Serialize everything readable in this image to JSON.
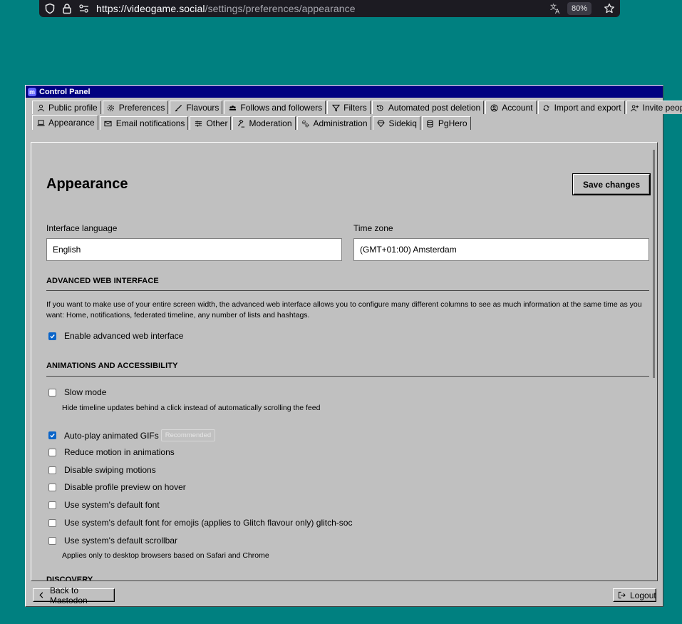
{
  "browser": {
    "url_host": "https://videogame.social",
    "url_path": "/settings/preferences/appearance",
    "zoom": "80%",
    "icons": [
      "shield-icon",
      "lock-icon",
      "site-settings-icon",
      "translate-icon",
      "star-icon"
    ]
  },
  "window": {
    "title": "Control Panel",
    "logo_letter": "m"
  },
  "tabs_row1": [
    {
      "label": "Public profile",
      "icon": "user-icon"
    },
    {
      "label": "Preferences",
      "icon": "gear-icon"
    },
    {
      "label": "Flavours",
      "icon": "paintbrush-icon"
    },
    {
      "label": "Follows and followers",
      "icon": "users-icon"
    },
    {
      "label": "Filters",
      "icon": "filter-icon"
    },
    {
      "label": "Automated post deletion",
      "icon": "history-icon"
    },
    {
      "label": "Account",
      "icon": "account-circle-icon"
    },
    {
      "label": "Import and export",
      "icon": "cloud-sync-icon"
    },
    {
      "label": "Invite people",
      "icon": "user-plus-icon"
    }
  ],
  "tabs_row2": [
    {
      "label": "Appearance",
      "icon": "laptop-icon",
      "active": true
    },
    {
      "label": "Email notifications",
      "icon": "envelope-icon"
    },
    {
      "label": "Other",
      "icon": "sliders-icon"
    },
    {
      "label": "Moderation",
      "icon": "gavel-icon"
    },
    {
      "label": "Administration",
      "icon": "cogs-icon"
    },
    {
      "label": "Sidekiq",
      "icon": "diamond-icon"
    },
    {
      "label": "PgHero",
      "icon": "database-icon"
    }
  ],
  "page": {
    "title": "Appearance",
    "save_label": "Save changes",
    "language_label": "Interface language",
    "language_value": "English",
    "timezone_label": "Time zone",
    "timezone_value": "(GMT+01:00) Amsterdam"
  },
  "advanced": {
    "heading": "ADVANCED WEB INTERFACE",
    "description": "If you want to make use of your entire screen width, the advanced web interface allows you to configure many different columns to see as much information at the same time as you want: Home, notifications, federated timeline, any number of lists and hashtags.",
    "enable_label": "Enable advanced web interface",
    "enable_checked": true
  },
  "animations": {
    "heading": "ANIMATIONS AND ACCESSIBILITY",
    "options": [
      {
        "label": "Slow mode",
        "checked": false,
        "hint": "Hide timeline updates behind a click instead of automatically scrolling the feed"
      },
      {
        "label": "Auto-play animated GIFs",
        "checked": true,
        "badge": "Recommended"
      },
      {
        "label": "Reduce motion in animations",
        "checked": false
      },
      {
        "label": "Disable swiping motions",
        "checked": false
      },
      {
        "label": "Disable profile preview on hover",
        "checked": false
      },
      {
        "label": "Use system's default font",
        "checked": false
      },
      {
        "label": "Use system's default font for emojis (applies to Glitch flavour only) glitch-soc",
        "checked": false
      },
      {
        "label": "Use system's default scrollbar",
        "checked": false,
        "hint": "Applies only to desktop browsers based on Safari and Chrome"
      }
    ]
  },
  "discovery": {
    "heading": "DISCOVERY"
  },
  "footer": {
    "back_label": "Back to Mastodon",
    "logout_label": "Logout"
  },
  "colors": {
    "desktop": "#008080",
    "titlebar": "#000080",
    "window": "#c0c0c0",
    "checkbox_on": "#0a64c8"
  }
}
